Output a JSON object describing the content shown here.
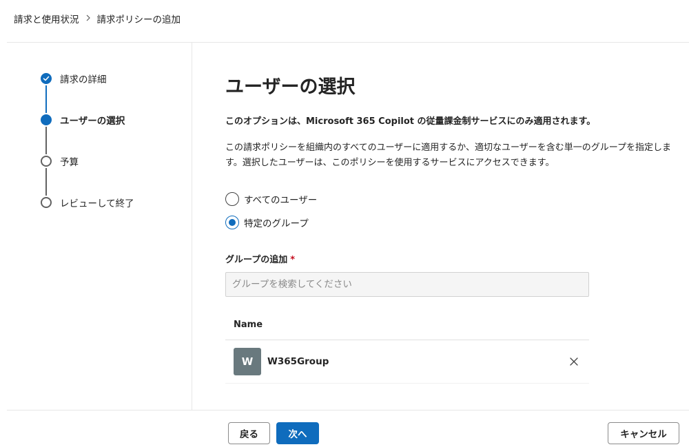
{
  "breadcrumb": {
    "items": [
      "請求と使用状況",
      "請求ポリシーの追加"
    ],
    "separator": ">"
  },
  "stepper": {
    "steps": [
      {
        "label": "請求の詳細",
        "state": "done"
      },
      {
        "label": "ユーザーの選択",
        "state": "current"
      },
      {
        "label": "予算",
        "state": "todo"
      },
      {
        "label": "レビューして終了",
        "state": "todo"
      }
    ]
  },
  "main": {
    "title": "ユーザーの選択",
    "notice": "このオプションは、Microsoft 365 Copilot の従量課金制サービスにのみ適用されます。",
    "description": "この請求ポリシーを組織内のすべてのユーザーに適用するか、適切なユーザーを含む単一のグループを指定します。選択したユーザーは、このポリシーを使用するサービスにアクセスできます。",
    "options": [
      {
        "label": "すべてのユーザー",
        "checked": false
      },
      {
        "label": "特定のグループ",
        "checked": true
      }
    ],
    "group_field": {
      "label": "グループの追加",
      "required_mark": "*",
      "placeholder": "グループを検索してください",
      "value": ""
    },
    "table": {
      "header": "Name",
      "rows": [
        {
          "initial": "W",
          "name": "W365Group"
        }
      ]
    }
  },
  "footer": {
    "back_label": "戻る",
    "next_label": "次へ",
    "cancel_label": "キャンセル"
  },
  "colors": {
    "accent": "#0f6cbd",
    "avatar": "#69797e",
    "required": "#c50f1f"
  }
}
